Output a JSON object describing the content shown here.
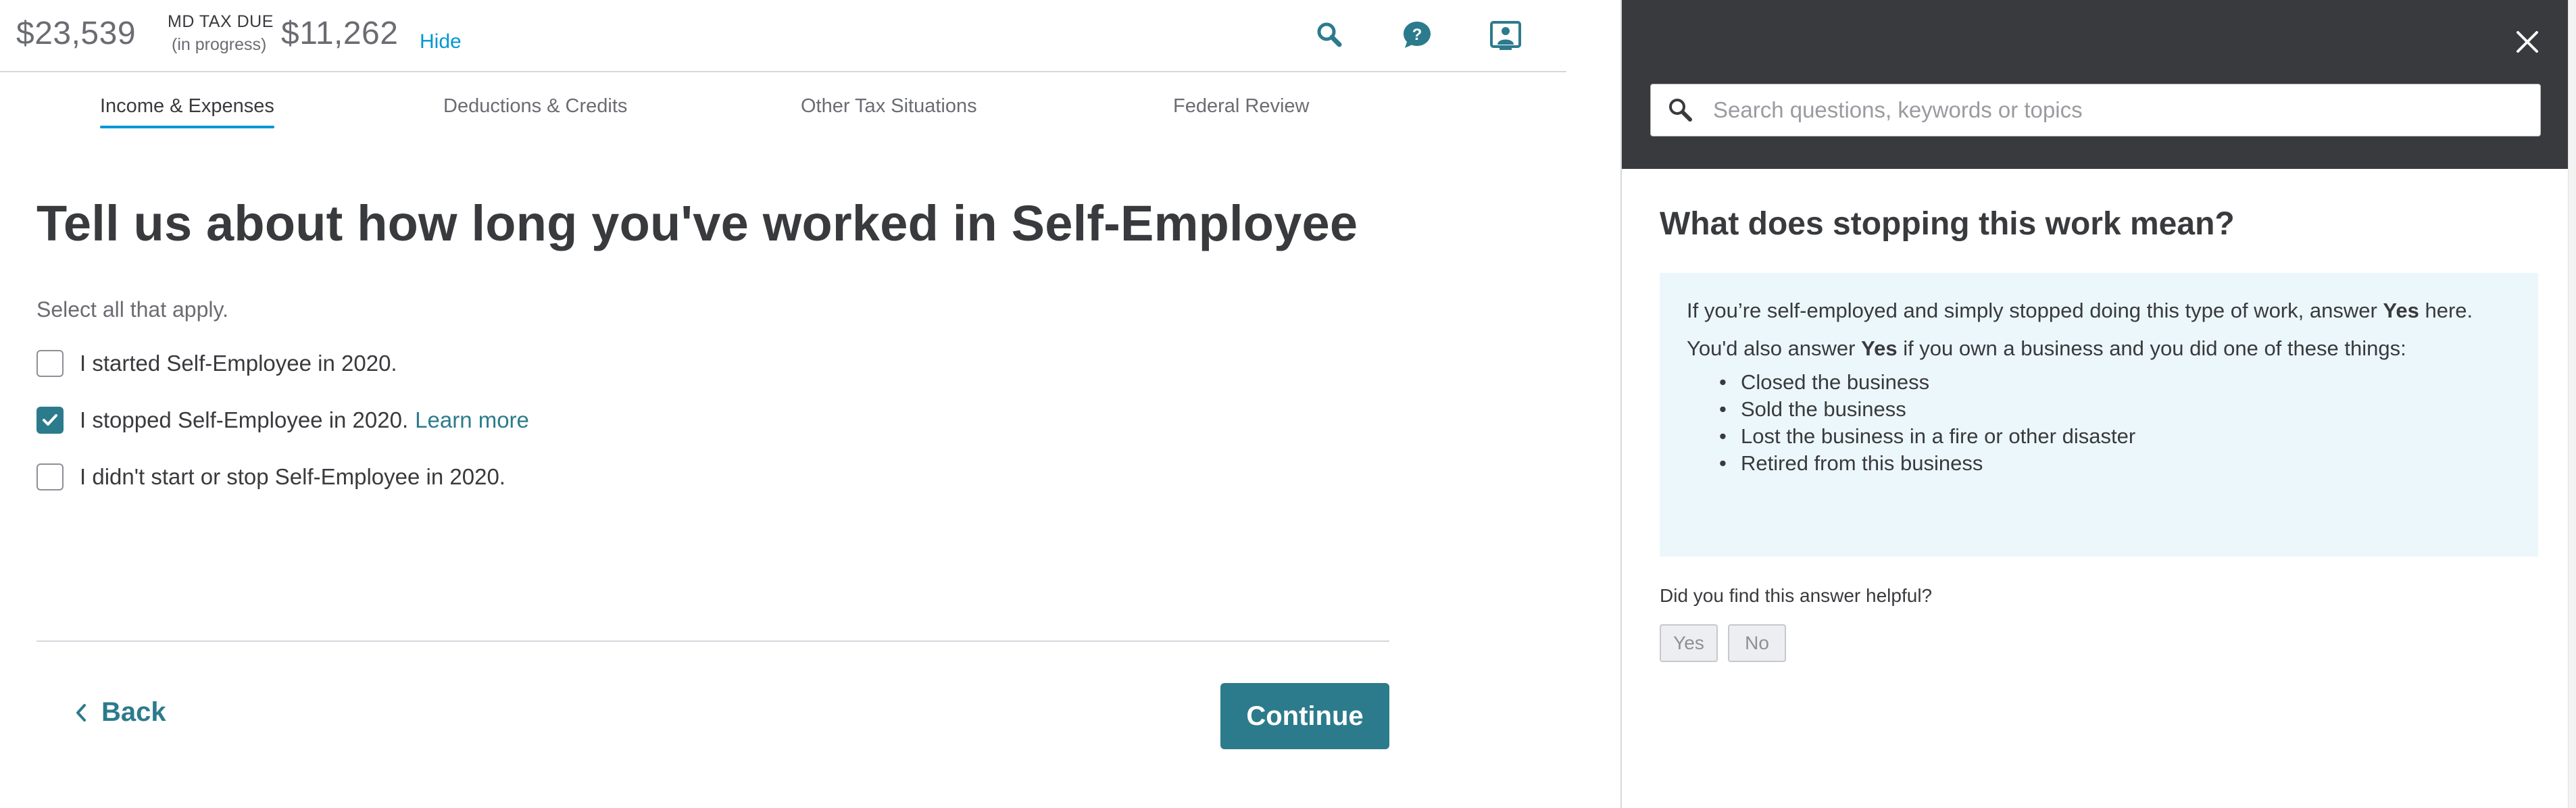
{
  "header": {
    "refund_amount": "$23,539",
    "tax_due_label": "MD TAX DUE",
    "tax_due_status": "(in progress)",
    "tax_due_amount": "$11,262",
    "hide_label": "Hide",
    "icons": [
      "search-icon",
      "help-icon",
      "expert-video-icon"
    ]
  },
  "tabs": [
    {
      "label": "Income & Expenses",
      "active": true
    },
    {
      "label": "Deductions & Credits",
      "active": false
    },
    {
      "label": "Other Tax Situations",
      "active": false
    },
    {
      "label": "Federal Review",
      "active": false
    }
  ],
  "main": {
    "title": "Tell us about how long you've worked in Self-Employee",
    "instruction": "Select all that apply.",
    "options": [
      {
        "label": "I started Self-Employee in 2020.",
        "checked": false
      },
      {
        "label": "I stopped Self-Employee in 2020.",
        "checked": true,
        "link": "Learn more"
      },
      {
        "label": "I didn't start or stop Self-Employee in 2020.",
        "checked": false
      }
    ],
    "back_label": "Back",
    "continue_label": "Continue"
  },
  "help_panel": {
    "search_placeholder": "Search questions, keywords or topics",
    "title": "What does stopping this work mean?",
    "para1_pre": "If you’re self-employed and simply stopped doing this type of work, answer ",
    "para1_bold": "Yes",
    "para1_post": " here.",
    "para2_pre": "You'd also answer ",
    "para2_bold": "Yes",
    "para2_post": " if you own a business and you did one of these things:",
    "list": [
      "Closed the business",
      "Sold the business",
      "Lost the business in a fire or other disaster",
      "Retired from this business"
    ],
    "helpful_question": "Did you find this answer helpful?",
    "yes_label": "Yes",
    "no_label": "No"
  },
  "colors": {
    "accent_blue": "#0097d4",
    "primary_teal": "#2c7b8c",
    "panel_header": "#393a3d",
    "answer_bg": "#ecf7fb"
  }
}
